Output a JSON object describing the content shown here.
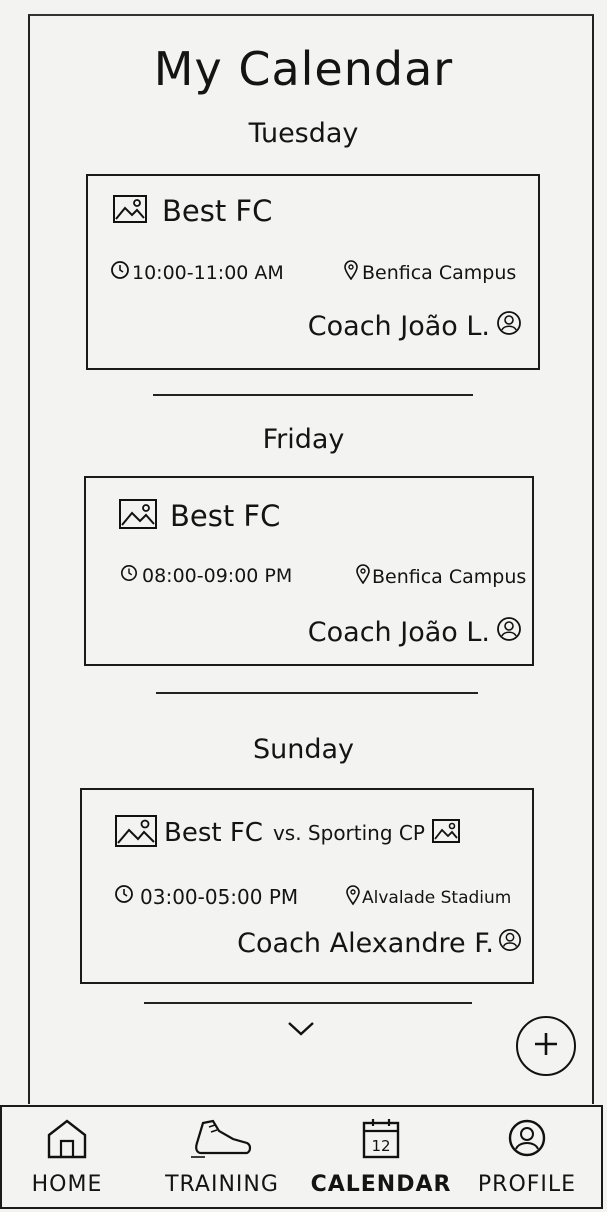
{
  "header": {
    "title": "My Calendar"
  },
  "events": [
    {
      "day": "Tuesday",
      "team": "Best FC",
      "opponent": "",
      "time": "10:00-11:00 AM",
      "location": "Benfica Campus",
      "coach": "Coach  João L."
    },
    {
      "day": "Friday",
      "team": "Best FC",
      "opponent": "",
      "time": "08:00-09:00 PM",
      "location": "Benfica Campus",
      "coach": "Coach  João L."
    },
    {
      "day": "Sunday",
      "team": "Best FC",
      "opponent": "vs.  Sporting CP",
      "time": "03:00-05:00 PM",
      "location": "Alvalade Stadium",
      "coach": "Coach Alexandre F."
    }
  ],
  "calendar_day": "12",
  "nav": [
    {
      "label": "HOME",
      "icon": "home-icon"
    },
    {
      "label": "TRAINING",
      "icon": "shoe-icon"
    },
    {
      "label": "CALENDAR",
      "icon": "calendar-icon"
    },
    {
      "label": "PROFILE",
      "icon": "profile-icon"
    }
  ],
  "colors": {
    "ink": "#141414",
    "paper": "#f3f3f1"
  }
}
